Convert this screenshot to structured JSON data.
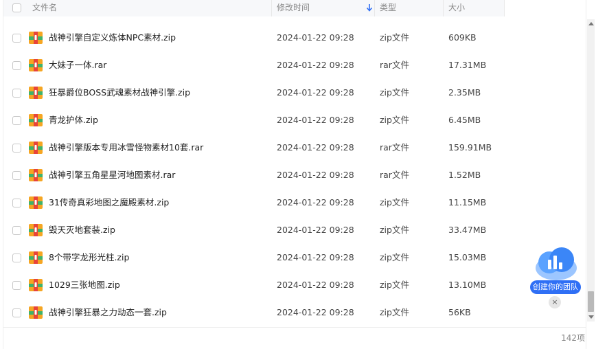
{
  "header": {
    "name_col": "文件名",
    "date_col": "修改时间",
    "type_col": "类型",
    "size_col": "大小"
  },
  "files": [
    {
      "name": "战神引擎自定义炼体NPC素材.zip",
      "date": "2024-01-22 09:28",
      "type": "zip文件",
      "size": "609KB"
    },
    {
      "name": "大妹子一体.rar",
      "date": "2024-01-22 09:28",
      "type": "rar文件",
      "size": "17.31MB"
    },
    {
      "name": "狂暴爵位BOSS武魂素材战神引擎.zip",
      "date": "2024-01-22 09:28",
      "type": "zip文件",
      "size": "2.35MB"
    },
    {
      "name": "青龙护体.zip",
      "date": "2024-01-22 09:28",
      "type": "zip文件",
      "size": "6.45MB"
    },
    {
      "name": "战神引擎版本专用冰雪怪物素材10套.rar",
      "date": "2024-01-22 09:28",
      "type": "rar文件",
      "size": "159.91MB"
    },
    {
      "name": "战神引擎五角星星河地图素材.rar",
      "date": "2024-01-22 09:28",
      "type": "rar文件",
      "size": "1.52MB"
    },
    {
      "name": "31传奇真彩地图之魔殿素材.zip",
      "date": "2024-01-22 09:28",
      "type": "zip文件",
      "size": "11.15MB"
    },
    {
      "name": "毁天灭地套装.zip",
      "date": "2024-01-22 09:28",
      "type": "zip文件",
      "size": "33.47MB"
    },
    {
      "name": "8个带字龙形光柱.zip",
      "date": "2024-01-22 09:28",
      "type": "zip文件",
      "size": "15.03MB"
    },
    {
      "name": "1029三张地图.zip",
      "date": "2024-01-22 09:28",
      "type": "zip文件",
      "size": "13.10MB"
    },
    {
      "name": "战神引擎狂暴之力动态一套.zip",
      "date": "2024-01-22 09:28",
      "type": "zip文件",
      "size": "56KB"
    }
  ],
  "footer": {
    "count": "142项"
  },
  "team_widget": {
    "label": "创建你的团队",
    "close": "×"
  },
  "colors": {
    "accent": "#2f6ff5",
    "archive_icon": "#f5a623",
    "archive_band": "#3fb36a"
  }
}
